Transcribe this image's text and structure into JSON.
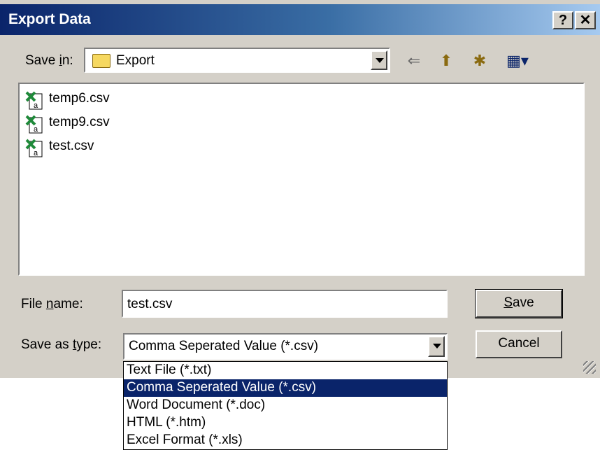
{
  "dialog": {
    "title": "Export Data",
    "help_glyph": "?",
    "close_glyph": "✕"
  },
  "save_in": {
    "label_pre": "Save ",
    "label_key": "i",
    "label_post": "n:",
    "value": "Export"
  },
  "toolbar": {
    "back_glyph": "⇐",
    "up_glyph": "⬆",
    "new_folder_glyph": "✱",
    "view_glyph": "▦▾"
  },
  "files": [
    {
      "name": "temp6.csv"
    },
    {
      "name": "temp9.csv"
    },
    {
      "name": "test.csv"
    }
  ],
  "file_name": {
    "label_pre": "File ",
    "label_key": "n",
    "label_post": "ame:",
    "value": "test.csv"
  },
  "save_as_type": {
    "label_pre": "Save as ",
    "label_key": "t",
    "label_post": "ype:",
    "value": "Comma Seperated Value (*.csv)",
    "options": [
      "Text File (*.txt)",
      "Comma Seperated Value (*.csv)",
      "Word Document (*.doc)",
      "HTML (*.htm)",
      "Excel Format (*.xls)"
    ],
    "selected_index": 1
  },
  "buttons": {
    "save_key": "S",
    "save_rest": "ave",
    "cancel": "Cancel"
  },
  "colors": {
    "title_start": "#0a246a",
    "title_end": "#a6caf0",
    "face": "#d4d0c8",
    "selection": "#0a246a"
  }
}
